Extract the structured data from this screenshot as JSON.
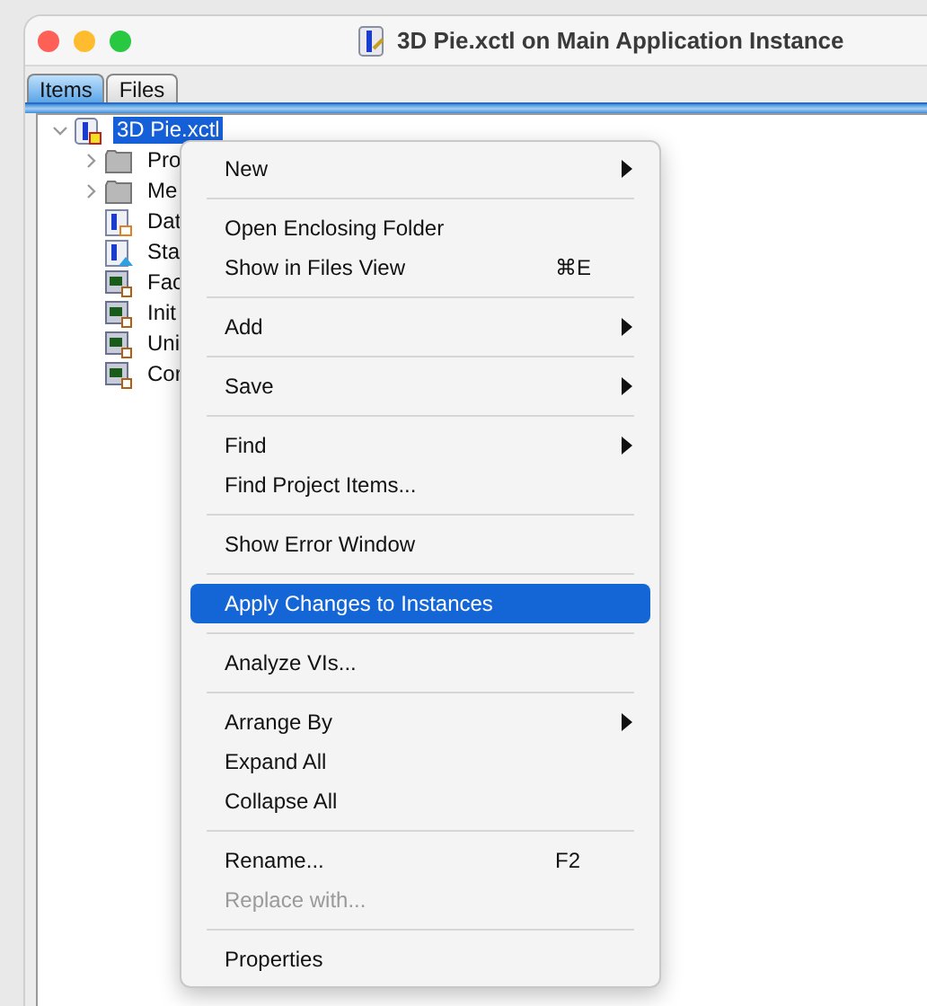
{
  "window": {
    "title": "3D Pie.xctl on Main Application Instance"
  },
  "tabs": [
    {
      "label": "Items",
      "selected": true
    },
    {
      "label": "Files",
      "selected": false
    }
  ],
  "tree": {
    "items": [
      {
        "label": "3D Pie.xctl",
        "kind": "xctl",
        "selected": true,
        "expanded": true,
        "children": [
          {
            "label": "Pro",
            "kind": "folder",
            "selected": false,
            "expanded": false
          },
          {
            "label": "Me",
            "kind": "folder",
            "selected": false,
            "expanded": false
          },
          {
            "label": "Dat",
            "kind": "data",
            "selected": false
          },
          {
            "label": "Sta",
            "kind": "state",
            "selected": false
          },
          {
            "label": "Fac",
            "kind": "vi",
            "selected": false
          },
          {
            "label": "Init",
            "kind": "vi",
            "selected": false
          },
          {
            "label": "Uni",
            "kind": "vi",
            "selected": false
          },
          {
            "label": "Cor",
            "kind": "vi",
            "selected": false
          }
        ]
      }
    ]
  },
  "context_menu": {
    "items": [
      {
        "kind": "item",
        "label": "New",
        "submenu": true,
        "selected": false,
        "disabled": false
      },
      {
        "kind": "separator"
      },
      {
        "kind": "item",
        "label": "Open Enclosing Folder",
        "selected": false,
        "disabled": false
      },
      {
        "kind": "item",
        "label": "Show in Files View",
        "shortcut": "⌘E",
        "selected": false,
        "disabled": false
      },
      {
        "kind": "separator"
      },
      {
        "kind": "item",
        "label": "Add",
        "submenu": true,
        "selected": false,
        "disabled": false
      },
      {
        "kind": "separator"
      },
      {
        "kind": "item",
        "label": "Save",
        "submenu": true,
        "selected": false,
        "disabled": false
      },
      {
        "kind": "separator"
      },
      {
        "kind": "item",
        "label": "Find",
        "submenu": true,
        "selected": false,
        "disabled": false
      },
      {
        "kind": "item",
        "label": "Find Project Items...",
        "selected": false,
        "disabled": false
      },
      {
        "kind": "separator"
      },
      {
        "kind": "item",
        "label": "Show Error Window",
        "selected": false,
        "disabled": false
      },
      {
        "kind": "separator"
      },
      {
        "kind": "item",
        "label": "Apply Changes to Instances",
        "selected": true,
        "disabled": false
      },
      {
        "kind": "separator"
      },
      {
        "kind": "item",
        "label": "Analyze VIs...",
        "selected": false,
        "disabled": false
      },
      {
        "kind": "separator"
      },
      {
        "kind": "item",
        "label": "Arrange By",
        "submenu": true,
        "selected": false,
        "disabled": false
      },
      {
        "kind": "item",
        "label": "Expand All",
        "selected": false,
        "disabled": false
      },
      {
        "kind": "item",
        "label": "Collapse All",
        "selected": false,
        "disabled": false
      },
      {
        "kind": "separator"
      },
      {
        "kind": "item",
        "label": "Rename...",
        "shortcut": "F2",
        "selected": false,
        "disabled": false
      },
      {
        "kind": "item",
        "label": "Replace with...",
        "selected": false,
        "disabled": true
      },
      {
        "kind": "separator"
      },
      {
        "kind": "item",
        "label": "Properties",
        "selected": false,
        "disabled": false
      }
    ]
  }
}
